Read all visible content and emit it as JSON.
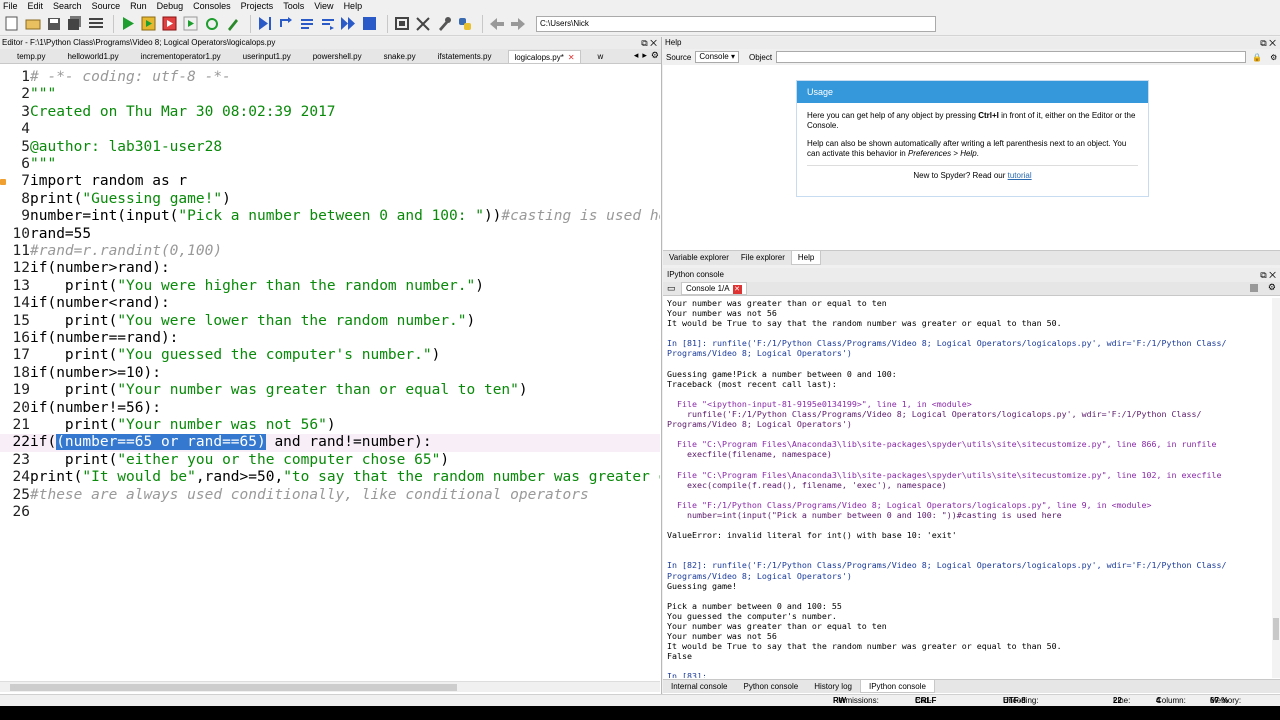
{
  "menu": [
    "File",
    "Edit",
    "Search",
    "Source",
    "Run",
    "Debug",
    "Consoles",
    "Projects",
    "Tools",
    "View",
    "Help"
  ],
  "toolbar": {
    "path": "C:\\Users\\Nick"
  },
  "editor": {
    "title": "Editor - F:\\1\\Python Class\\Programs\\Video 8; Logical Operators\\logicalops.py",
    "tabs": [
      "temp.py",
      "helloworld1.py",
      "incrementoperator1.py",
      "userinput1.py",
      "powershell.py",
      "snake.py",
      "ifstatements.py",
      "logicalops.py*",
      "w"
    ],
    "active_tab": "logicalops.py*",
    "current_line": "22"
  },
  "help": {
    "title": "Help",
    "source_label": "Source",
    "source_value": "Console",
    "object_label": "Object",
    "usage_title": "Usage",
    "usage_p1_a": "Here you can get help of any object by pressing ",
    "usage_p1_b": "Ctrl+I",
    "usage_p1_c": " in front of it, either on the Editor or the Console.",
    "usage_p2_a": "Help can also be shown automatically after writing a left parenthesis next to an object. You can activate this behavior in ",
    "usage_p2_b": "Preferences > Help",
    "usage_p2_c": ".",
    "new_text": "New to Spyder? Read our ",
    "tutorial_link": "tutorial",
    "tabs": [
      "Variable explorer",
      "File explorer",
      "Help"
    ]
  },
  "console": {
    "title": "IPython console",
    "tab": "Console 1/A",
    "bottom_tabs": [
      "Internal console",
      "Python console",
      "History log",
      "IPython console"
    ],
    "lines": [
      {
        "t": "Your number was greater than or equal to ten",
        "c": ""
      },
      {
        "t": "Your number was not 56",
        "c": ""
      },
      {
        "t": "It would be True to say that the random number was greater or equal to than 50.",
        "c": ""
      },
      {
        "t": "",
        "c": ""
      },
      {
        "t": "In [81]: runfile('F:/1/Python Class/Programs/Video 8; Logical Operators/logicalops.py', wdir='F:/1/Python Class/",
        "c": "blue"
      },
      {
        "t": "Programs/Video 8; Logical Operators')",
        "c": "blue"
      },
      {
        "t": "",
        "c": ""
      },
      {
        "t": "Guessing game!Pick a number between 0 and 100:",
        "c": ""
      },
      {
        "t": "Traceback (most recent call last):",
        "c": ""
      },
      {
        "t": "",
        "c": ""
      },
      {
        "t": "  File \"<ipython-input-81-9195e0134199>\", line 1, in <module>",
        "c": "purple"
      },
      {
        "t": "    runfile('F:/1/Python Class/Programs/Video 8; Logical Operators/logicalops.py', wdir='F:/1/Python Class/",
        "c": "darkred"
      },
      {
        "t": "Programs/Video 8; Logical Operators')",
        "c": "darkred"
      },
      {
        "t": "",
        "c": ""
      },
      {
        "t": "  File \"C:\\Program Files\\Anaconda3\\lib\\site-packages\\spyder\\utils\\site\\sitecustomize.py\", line 866, in runfile",
        "c": "purple"
      },
      {
        "t": "    execfile(filename, namespace)",
        "c": "darkred"
      },
      {
        "t": "",
        "c": ""
      },
      {
        "t": "  File \"C:\\Program Files\\Anaconda3\\lib\\site-packages\\spyder\\utils\\site\\sitecustomize.py\", line 102, in execfile",
        "c": "purple"
      },
      {
        "t": "    exec(compile(f.read(), filename, 'exec'), namespace)",
        "c": "darkred"
      },
      {
        "t": "",
        "c": ""
      },
      {
        "t": "  File \"F:/1/Python Class/Programs/Video 8; Logical Operators/logicalops.py\", line 9, in <module>",
        "c": "purple"
      },
      {
        "t": "    number=int(input(\"Pick a number between 0 and 100: \"))#casting is used here",
        "c": "darkred"
      },
      {
        "t": "",
        "c": ""
      },
      {
        "t": "ValueError: invalid literal for int() with base 10: 'exit'",
        "c": ""
      },
      {
        "t": "",
        "c": ""
      },
      {
        "t": "",
        "c": ""
      },
      {
        "t": "In [82]: runfile('F:/1/Python Class/Programs/Video 8; Logical Operators/logicalops.py', wdir='F:/1/Python Class/",
        "c": "blue"
      },
      {
        "t": "Programs/Video 8; Logical Operators')",
        "c": "blue"
      },
      {
        "t": "Guessing game!",
        "c": ""
      },
      {
        "t": "",
        "c": ""
      },
      {
        "t": "Pick a number between 0 and 100: 55",
        "c": ""
      },
      {
        "t": "You guessed the computer's number.",
        "c": ""
      },
      {
        "t": "Your number was greater than or equal to ten",
        "c": ""
      },
      {
        "t": "Your number was not 56",
        "c": ""
      },
      {
        "t": "It would be True to say that the random number was greater or equal to than 50.",
        "c": ""
      },
      {
        "t": "False",
        "c": ""
      },
      {
        "t": "",
        "c": ""
      },
      {
        "t": "In [83]:",
        "c": "blue"
      }
    ]
  },
  "status": {
    "permissions_label": "Permissions:",
    "permissions": "RW",
    "eol_label": "End-of-lines:",
    "eol": "CRLF",
    "encoding_label": "Encoding:",
    "encoding": "UTF-8",
    "line_label": "Line:",
    "line": "22",
    "column_label": "Column:",
    "column": "4",
    "memory_label": "Memory:",
    "memory": "67 %"
  },
  "colors": {
    "string": "#0a8a0a",
    "selection": "#3478cf",
    "usage_header": "#3498db",
    "current_line": "#f7eef7"
  }
}
